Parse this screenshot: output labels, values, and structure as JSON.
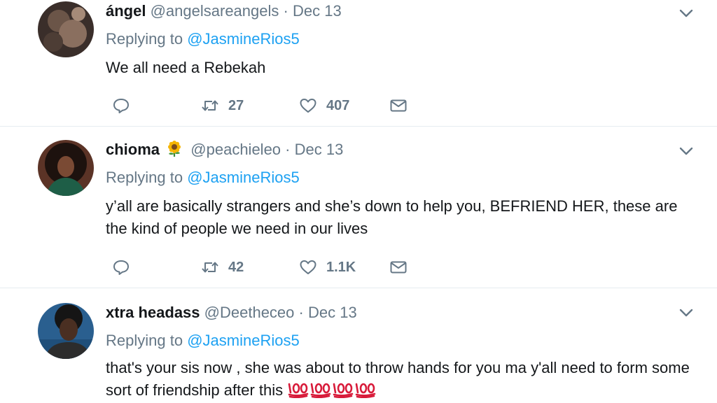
{
  "colors": {
    "link": "#1da1f2",
    "muted": "#657786",
    "text": "#14171a",
    "divider": "#e6ecf0"
  },
  "tweets": [
    {
      "display_name": "ángel",
      "handle": "@angelsareangels",
      "separator": "·",
      "date": "Dec 13",
      "reply_prefix": "Replying to",
      "reply_to": "@JasmineRios5",
      "text": "We all need a Rebekah",
      "retweets": "27",
      "likes": "407"
    },
    {
      "display_name": "chioma",
      "name_emoji": "sunflower-emoji",
      "handle": "@peachieleo",
      "separator": "·",
      "date": "Dec 13",
      "reply_prefix": "Replying to",
      "reply_to": "@JasmineRios5",
      "text": "y’all are basically strangers and she’s down to help you, BEFRIEND HER, these are the kind of people we need in our lives",
      "retweets": "42",
      "likes": "1.1K"
    },
    {
      "display_name": "xtra headass",
      "handle": "@Deetheceo",
      "separator": "·",
      "date": "Dec 13",
      "reply_prefix": "Replying to",
      "reply_to": "@JasmineRios5",
      "text": "that's your sis now , she was about to throw hands for you ma y'all need to form some sort of friendship after this",
      "text_emoji": "hundred-points-emoji x4"
    }
  ]
}
